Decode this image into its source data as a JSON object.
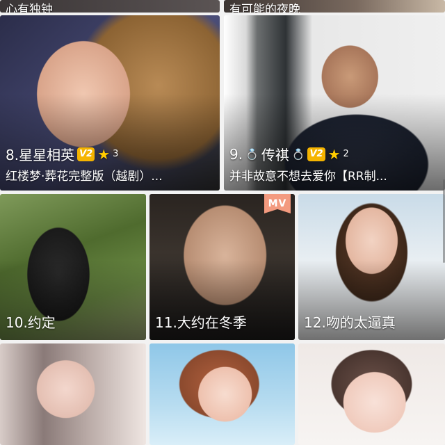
{
  "top_row": [
    {
      "caption": "心有独钟"
    },
    {
      "caption": "有可能的夜晚"
    }
  ],
  "featured": [
    {
      "rank_name": "8.星星相英",
      "level": "V2",
      "stars": "3",
      "song": "红楼梦·葬花完整版（越剧）..."
    },
    {
      "rank_name": "9.",
      "ring_left": "💍",
      "name": "传祺",
      "ring_right": "💍",
      "level": "V2",
      "stars": "2",
      "song": "并非故意不想去爱你【RR制..."
    }
  ],
  "grid": [
    {
      "caption": "10.约定"
    },
    {
      "caption": "11.大约在冬季",
      "badge": "MV"
    },
    {
      "caption": "12.吻的太逼真"
    }
  ],
  "bottom_row": [
    {
      "caption": ""
    },
    {
      "caption": ""
    },
    {
      "caption": ""
    }
  ],
  "colors": {
    "badge_gold": "#f5b400",
    "star_yellow": "#ffcc00",
    "mv_badge": "#f39a7f"
  },
  "icons": [
    "vip-level-icon",
    "star-icon",
    "ring-icon",
    "mv-badge-icon"
  ]
}
